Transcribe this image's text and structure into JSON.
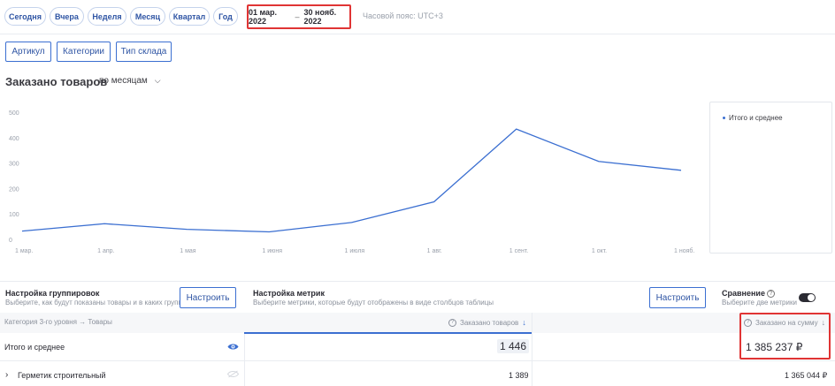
{
  "period_buttons": [
    "Сегодня",
    "Вчера",
    "Неделя",
    "Месяц",
    "Квартал",
    "Год"
  ],
  "date_range": {
    "start": "01 мар. 2022",
    "separator": "–",
    "end": "30 нояб. 2022"
  },
  "timezone": "Часовой пояс: UTC+3",
  "filters": [
    "Артикул",
    "Категории",
    "Тип склада"
  ],
  "section": {
    "title": "Заказано товаров",
    "granularity": "по месяцам"
  },
  "legend": {
    "item": "Итого и среднее"
  },
  "colors": {
    "accent": "#3b6fd1",
    "highlight": "#e03434",
    "text": "#2b2b33"
  },
  "chart_data": {
    "type": "line",
    "categories": [
      "1 мар.",
      "1 апр.",
      "1 мая",
      "1 июня",
      "1 июля",
      "1 авг.",
      "1 сент.",
      "1 окт.",
      "1 нояб."
    ],
    "series": [
      {
        "name": "Итого и среднее",
        "values": [
          36,
          65,
          43,
          33,
          70,
          151,
          437,
          310,
          275
        ]
      }
    ],
    "yticks": [
      0,
      100,
      200,
      300,
      400,
      500
    ],
    "ylim": [
      0,
      500
    ],
    "grid": false,
    "legend_position": "right"
  },
  "grouping": {
    "title": "Настройка группировок",
    "desc": "Выберите, как будут показаны товары и в каких группах",
    "button": "Настроить"
  },
  "metrics": {
    "title": "Настройка метрик",
    "desc": "Выберите метрики, которые будут отображены в виде столбцов таблицы",
    "button": "Настроить"
  },
  "comparison": {
    "title": "Сравнение",
    "desc": "Выберите две метрики"
  },
  "table": {
    "header": {
      "category": "Категория 3-го уровня → Товары",
      "col1": "Заказано товаров",
      "col2": "Заказано на сумму"
    },
    "rows": [
      {
        "name": "Итого и среднее",
        "col1": "1 446",
        "col2": "1 385 237 ₽"
      },
      {
        "name": "Герметик строительный",
        "col1": "1 389",
        "col2": "1 365 044 ₽"
      }
    ]
  }
}
